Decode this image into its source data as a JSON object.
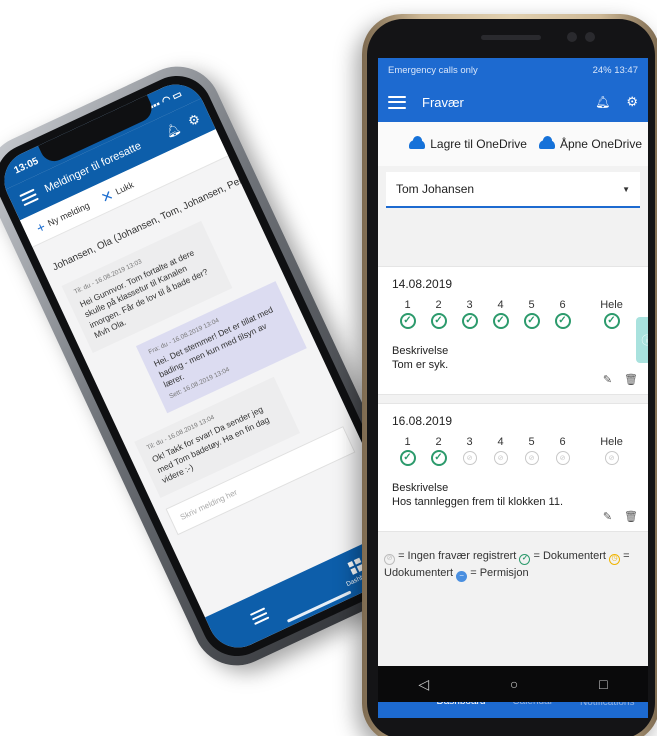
{
  "iphone": {
    "status": {
      "time": "13:05",
      "signal": "▪▪▪ ◠ ▭"
    },
    "appbar": {
      "title": "Meldinger til foresatte"
    },
    "actions": {
      "new_label": "Ny melding",
      "close_label": "Lukk",
      "close_x": "✕"
    },
    "thread": {
      "participants": "Johansen, Ola (Johansen, Tom, Johansen, Per)",
      "messages": [
        {
          "meta": "Til: du - 16.08.2019 13:03",
          "text": "Hei Gunnvor. Tom fortalte at dere skulle på klassetur til Kanalen imorgen. Får de lov til å bade der? Mvh Ola.",
          "seen": ""
        },
        {
          "meta": "Fra: du - 16.08.2019 13:04",
          "text": "Hei. Det stemmer! Det er tillat med bading - men kun med tilsyn av lærer.",
          "seen": "Sett: 16.08.2019 13:04"
        },
        {
          "meta": "Til: du - 16.08.2019 13:04",
          "text": "Ok! Takk for svar! Da sender jeg med Tom badetøy. Ha en fin dag videre :-)",
          "seen": ""
        }
      ],
      "compose_placeholder": "Skriv melding her"
    },
    "tabbar": {
      "dashboard_label": "Dashboard"
    }
  },
  "android": {
    "status": {
      "left": "Emergency calls only",
      "right": "24% 13:47"
    },
    "appbar": {
      "title": "Fravær"
    },
    "onedrive": {
      "save_label": "Lagre til OneDrive",
      "open_label": "Åpne OneDrive"
    },
    "student_select": {
      "value": "Tom Johansen"
    },
    "days": [
      {
        "date": "14.08.2019",
        "periods": [
          "1",
          "2",
          "3",
          "4",
          "5",
          "6"
        ],
        "status": [
          "documented",
          "documented",
          "documented",
          "documented",
          "documented",
          "documented"
        ],
        "whole_label": "Hele",
        "whole_status": "documented",
        "desc_label": "Beskrivelse",
        "desc": "Tom er syk."
      },
      {
        "date": "16.08.2019",
        "periods": [
          "1",
          "2",
          "3",
          "4",
          "5",
          "6"
        ],
        "status": [
          "documented",
          "documented",
          "none",
          "none",
          "none",
          "none"
        ],
        "whole_label": "Hele",
        "whole_status": "none",
        "desc_label": "Beskrivelse",
        "desc": "Hos tannleggen frem til klokken 11."
      }
    ],
    "legend": {
      "none_text": "= Ingen fravær registrert",
      "doc_text": "= Dokumentert",
      "undoc_text": "= Udokumentert",
      "perm_text": "= Permisjon"
    },
    "tabbar": {
      "dashboard_label": "Dashboard",
      "calendar_label": "Calendar",
      "notifications_label": "Notifications"
    }
  },
  "colors": {
    "primary": "#1d6ad0",
    "ios_primary": "#0d5eaa",
    "documented": "#2c9a6c",
    "undocumented": "#f0b400",
    "permission": "#4a8fe0"
  }
}
